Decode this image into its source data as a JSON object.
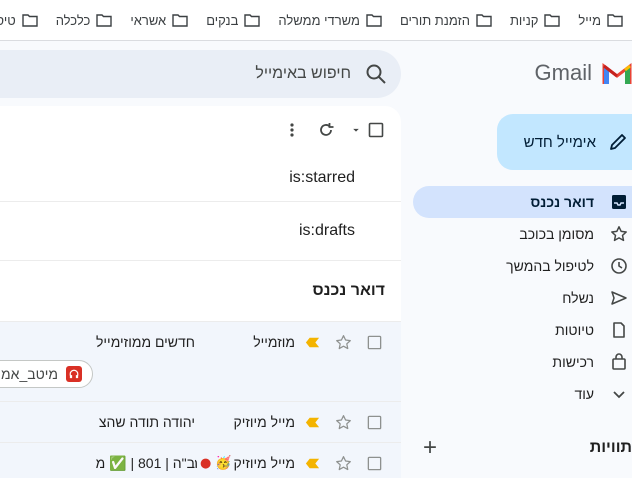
{
  "bookmarks": [
    "מייל",
    "קניות",
    "הזמנת תורים",
    "משרדי ממשלה",
    "בנקים",
    "אשראי",
    "כלכלה",
    "טיסות"
  ],
  "brand": {
    "name": "Gmail"
  },
  "compose": {
    "label": "אימייל חדש"
  },
  "nav": [
    {
      "label": "דואר נכנס",
      "icon": "inbox-icon",
      "active": true
    },
    {
      "label": "מסומן בכוכב",
      "icon": "star-icon"
    },
    {
      "label": "לטיפול בהמשך",
      "icon": "clock-icon"
    },
    {
      "label": "נשלח",
      "icon": "send-icon"
    },
    {
      "label": "טיוטות",
      "icon": "draft-icon"
    },
    {
      "label": "רכישות",
      "icon": "shopping-bag-icon"
    },
    {
      "label": "עוד",
      "icon": "chevron-down-icon"
    }
  ],
  "labels": {
    "title": "תוויות",
    "add": "+"
  },
  "search": {
    "placeholder": "חיפוש באימייל"
  },
  "saved_searches": [
    "is:starred",
    "is:drafts"
  ],
  "section": {
    "title": "דואר נכנס"
  },
  "emails": [
    {
      "sender": "מוזמייל",
      "subject": "חדשים ממוזימייל",
      "chip": "מיטב_אמ"
    },
    {
      "sender": "מייל מיוזיק",
      "subject": "יהודה תודה שהצ"
    },
    {
      "sender": "מייל מיוזיק",
      "sender_extra": "ח.",
      "subject": "ב\"ה | 801 | ✅ מ"
    }
  ],
  "colors": {
    "accent": "#c2e7ff",
    "active_nav": "#d3e3fd",
    "important": "#f4b400"
  }
}
